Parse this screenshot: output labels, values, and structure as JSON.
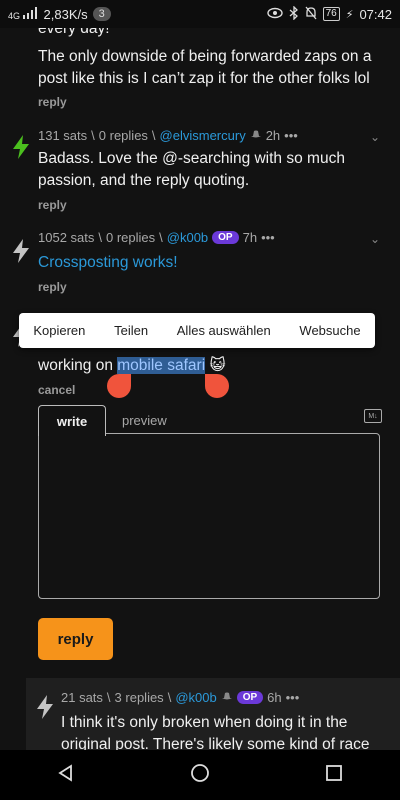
{
  "status_bar": {
    "network_type": "4G",
    "speed": "2,83K/s",
    "notification_count": "3",
    "battery": "76",
    "time": "07:42"
  },
  "comments": [
    {
      "partial_top": "every day!",
      "body": "The only downside of being forwarded zaps on a post like this is I can’t zap it for the other folks lol",
      "reply_label": "reply"
    },
    {
      "sats": "131 sats",
      "replies": "0 replies",
      "user": "@elvismercury",
      "age": "2h",
      "body": "Badass.  Love the @-searching with so much passion, and the reply quoting.",
      "reply_label": "reply"
    },
    {
      "sats": "1052 sats",
      "replies": "0 replies",
      "user": "@k00b",
      "op_badge": "OP",
      "age": "7h",
      "body": "Crossposting works!",
      "reply_label": "reply"
    }
  ],
  "context_menu": {
    "items": [
      "Kopieren",
      "Teilen",
      "Alles auswählen",
      "Websuche"
    ]
  },
  "editing_comment": {
    "body_before": "working on ",
    "body_selected": "mobile safari",
    "emoji": "😺",
    "cancel_label": "cancel"
  },
  "editor": {
    "tab_write": "write",
    "tab_preview": "preview",
    "markdown_icon": "M↓",
    "submit_label": "reply"
  },
  "nested_comment": {
    "sats": "21 sats",
    "replies": "3 replies",
    "user": "@k00b",
    "op_badge": "OP",
    "age": "6h",
    "body": "I think it's only broken when doing it in the original post. There's likely some kind of race"
  },
  "colors": {
    "accent_orange": "#f6931a",
    "link_blue": "#2b99d9",
    "op_purple": "#6b39d8",
    "zapped_green": "#4bbf1e"
  }
}
